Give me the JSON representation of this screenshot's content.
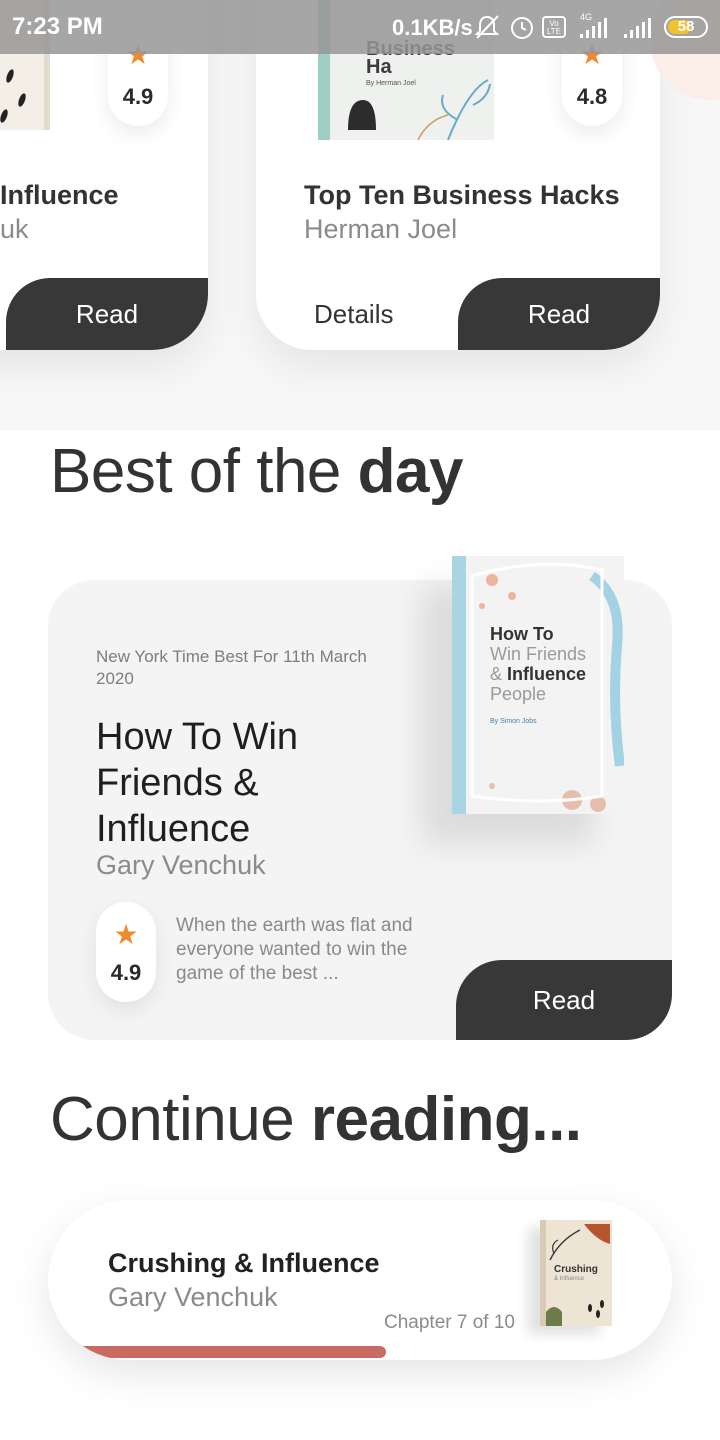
{
  "status_bar": {
    "time": "7:23 PM",
    "net_speed": "0.1KB/s",
    "volte": "Vo LTE",
    "network_type": "4G",
    "battery": "58"
  },
  "carousel": {
    "left_card": {
      "title": "Influence",
      "author": "uk",
      "rating": "4.9",
      "read_label": "Read"
    },
    "right_card": {
      "title": "Top Ten Business Hacks",
      "author": "Herman Joel",
      "rating": "4.8",
      "details_label": "Details",
      "read_label": "Read",
      "cover_text": "Business Ha",
      "cover_author": "By Herman Joel"
    }
  },
  "best_section": {
    "heading_light": "Best of the",
    "heading_bold": "day",
    "eyebrow": "New York Time Best For 11th March 2020",
    "title": "How To Win Friends & Influence",
    "author": "Gary Venchuk",
    "rating": "4.9",
    "description": "When the earth was flat and everyone wanted to win the game of the best ...",
    "read_label": "Read",
    "cover": {
      "line1": "How To",
      "line2": "Win Friends",
      "line3_prefix": "&",
      "line3_bold": "Influence",
      "line4": "People",
      "byline": "By Simon Jobs"
    }
  },
  "continue_section": {
    "heading_light": "Continue",
    "heading_bold": "reading...",
    "title": "Crushing & Influence",
    "author": "Gary Venchuk",
    "chapter": "Chapter 7 of 10",
    "progress": 0.7,
    "cover": {
      "title": "Crushing",
      "subtitle": "& Influence"
    }
  },
  "colors": {
    "dark": "#383838",
    "star": "#f08a2e",
    "progress": "#c96b63",
    "card_bg": "#f4f4f4"
  },
  "icons": [
    "star-icon",
    "mute-icon",
    "alarm-icon",
    "volte-icon",
    "signal-icon",
    "battery-icon"
  ]
}
